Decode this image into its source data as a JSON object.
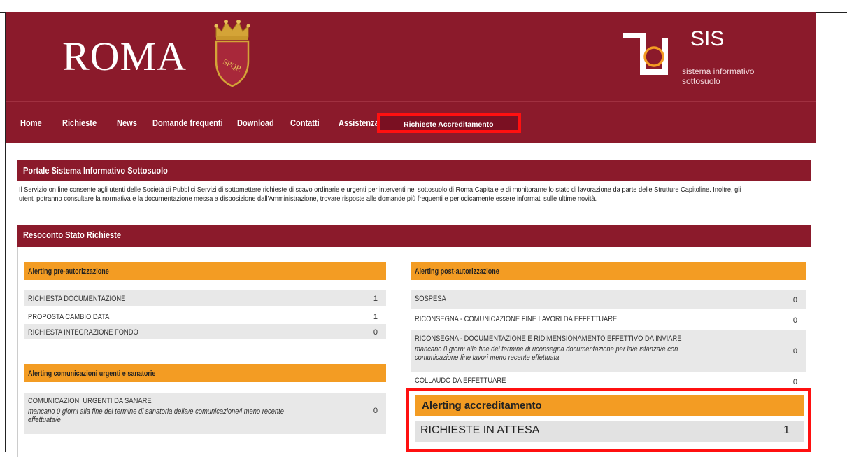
{
  "header": {
    "roma": "ROMA",
    "sis_title": "SIS",
    "sis_sub1": "sistema informativo",
    "sis_sub2": "sottosuolo",
    "brand_color": "#8b1a2b"
  },
  "nav": {
    "items": [
      "Home",
      "Richieste",
      "News",
      "Domande frequenti",
      "Download",
      "Contatti",
      "Assistenza"
    ],
    "special": "Richieste Accreditamento"
  },
  "portal": {
    "title": "Portale Sistema Informativo Sottosuolo",
    "line1": "Il Servizio on line consente agli utenti delle Società di Pubblici Servizi di sottomettere richieste di scavo ordinarie e urgenti per interventi nel sottosuolo di Roma Capitale e di monitorarne lo stato di lavorazione da parte delle Strutture Capitoline. Inoltre, gli",
    "line2": "utenti potranno consultare la normativa e la documentazione messa a disposizione dall'Amministrazione, trovare risposte alle domande più frequenti e periodicamente essere informati sulle ultime novità."
  },
  "resoconto": {
    "title": "Resoconto Stato Richieste"
  },
  "pre": {
    "title": "Alerting pre-autorizzazione",
    "rows": [
      {
        "label": "RICHIESTA DOCUMENTAZIONE",
        "value": "1"
      },
      {
        "label": "PROPOSTA CAMBIO DATA",
        "value": "1"
      },
      {
        "label": "RICHIESTA INTEGRAZIONE FONDO",
        "value": "0"
      }
    ]
  },
  "urgent": {
    "title": "Alerting comunicazioni urgenti e sanatorie",
    "label": "COMUNICAZIONI URGENTI DA SANARE",
    "note1": "mancano 0 giorni alla fine del termine di sanatoria della/e comunicazione/i meno recente",
    "note2": "effettuata/e",
    "value": "0"
  },
  "post": {
    "title": "Alerting post-autorizzazione",
    "row1": {
      "label": "SOSPESA",
      "value": "0"
    },
    "row2": {
      "label": "RICONSEGNA - COMUNICAZIONE FINE LAVORI DA EFFETTUARE",
      "value": "0"
    },
    "row3": {
      "label": "RICONSEGNA - DOCUMENTAZIONE E RIDIMENSIONAMENTO EFFETTIVO DA INVIARE",
      "note1": "mancano 0 giorni alla fine del termine di riconsegna documentazione per la/e istanza/e con",
      "note2": "comunicazione fine lavori meno recente effettuata",
      "value": "0"
    },
    "row4": {
      "label": "COLLAUDO DA EFFETTUARE",
      "value": "0"
    }
  },
  "accreditamento": {
    "title": "Alerting accreditamento",
    "label": "RICHIESTE IN ATTESA",
    "value": "1"
  }
}
